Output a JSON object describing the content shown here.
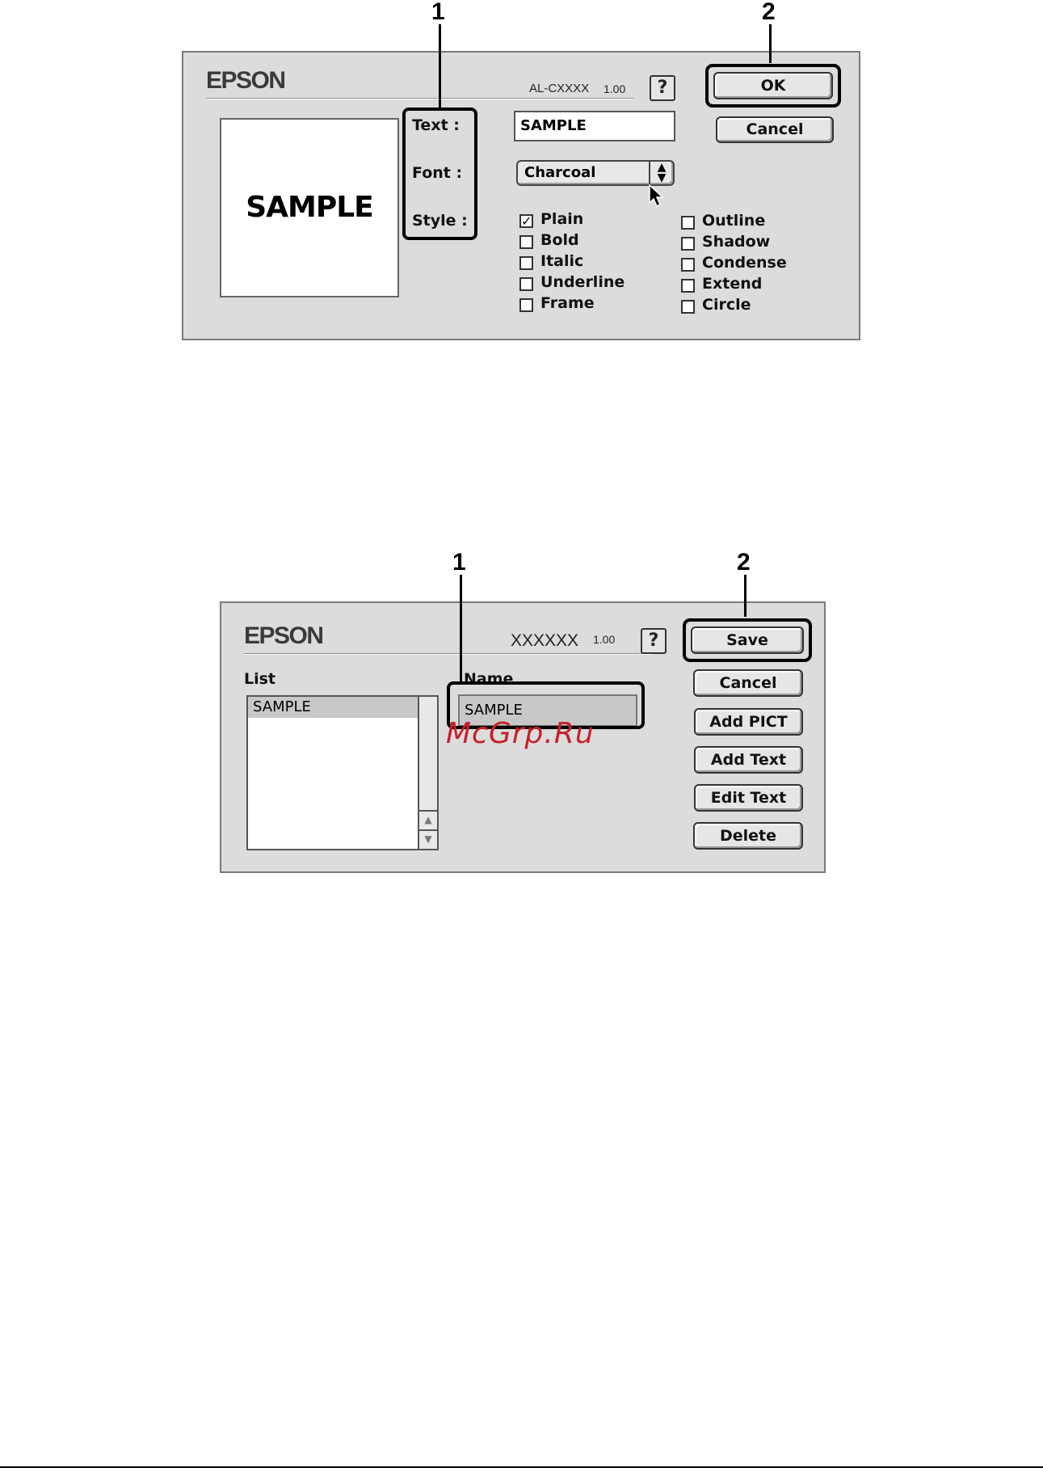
{
  "watermark": "McGrp.Ru",
  "dialog1": {
    "brand": "EPSON",
    "model": "AL-CXXXX",
    "version": "1.00",
    "help_label": "?",
    "preview_text": "SAMPLE",
    "text_label": "Text :",
    "font_label": "Font :",
    "style_label": "Style :",
    "text_value": "SAMPLE",
    "font_value": "Charcoal",
    "ok_label": "OK",
    "cancel_label": "Cancel",
    "styles_left": [
      {
        "label": "Plain",
        "checked": true
      },
      {
        "label": "Bold",
        "checked": false
      },
      {
        "label": "Italic",
        "checked": false
      },
      {
        "label": "Underline",
        "checked": false
      },
      {
        "label": "Frame",
        "checked": false
      }
    ],
    "styles_right": [
      {
        "label": "Outline",
        "checked": false
      },
      {
        "label": "Shadow",
        "checked": false
      },
      {
        "label": "Condense",
        "checked": false
      },
      {
        "label": "Extend",
        "checked": false
      },
      {
        "label": "Circle",
        "checked": false
      }
    ],
    "callouts": [
      "1",
      "2"
    ]
  },
  "dialog2": {
    "brand": "EPSON",
    "model": "XXXXXX",
    "version": "1.00",
    "help_label": "?",
    "list_label": "List",
    "list_items": [
      "SAMPLE"
    ],
    "name_label": "Name",
    "name_value": "SAMPLE",
    "buttons": {
      "save": "Save",
      "cancel": "Cancel",
      "add_pict": "Add PICT",
      "add_text": "Add Text",
      "edit_text": "Edit Text",
      "delete": "Delete"
    },
    "callouts": [
      "1",
      "2"
    ]
  }
}
